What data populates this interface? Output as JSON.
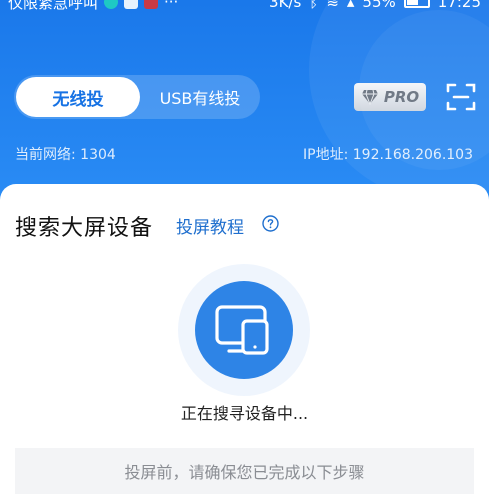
{
  "status_bar": {
    "left_text": "仅限紧急呼叫",
    "ellipsis": "···",
    "speed": "3K/s",
    "battery_pct": "55%",
    "time": "17:25"
  },
  "mode_switch": {
    "wireless": "无线投",
    "usb": "USB有线投"
  },
  "pro_label": "PRO",
  "network": {
    "current": "当前网络: 1304",
    "ip": "IP地址: 192.168.206.103"
  },
  "card": {
    "title": "搜索大屏设备",
    "tutorial": "投屏教程",
    "status": "正在搜寻设备中...",
    "notice": "投屏前，请确保您已完成以下步骤"
  },
  "colors": {
    "primary": "#1a78ea",
    "link": "#1f6fce",
    "circle": "#2e84e6"
  }
}
